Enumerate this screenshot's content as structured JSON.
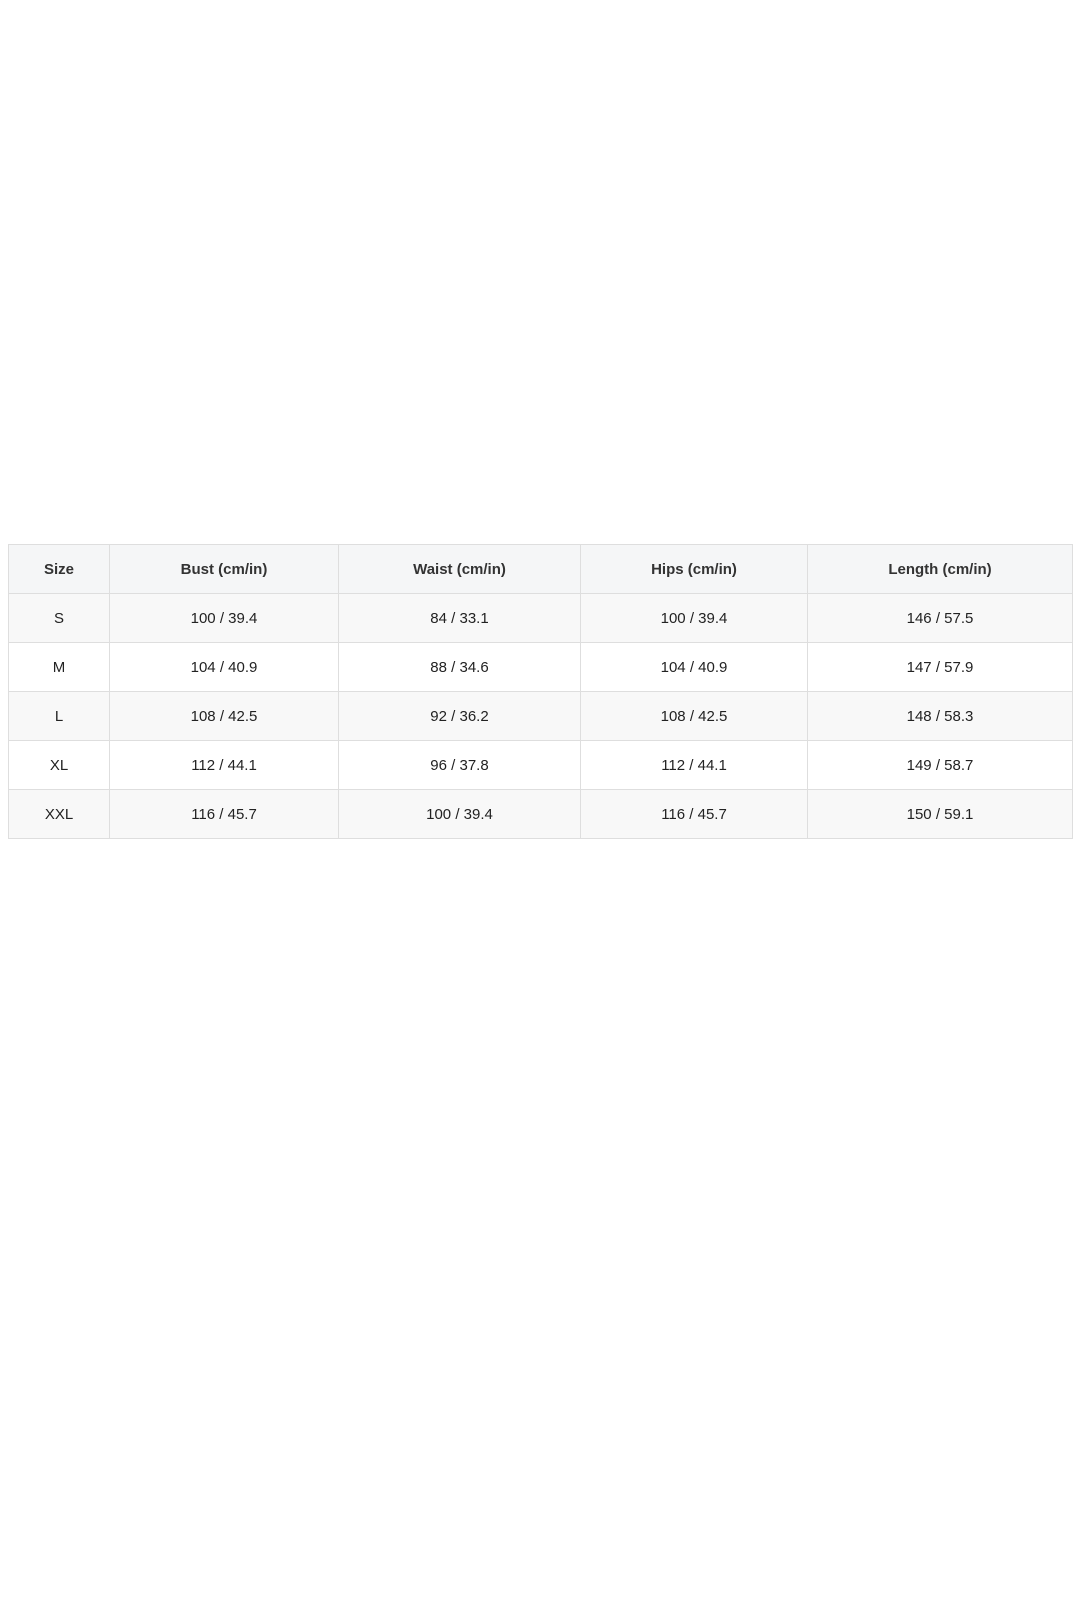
{
  "size_chart": {
    "headers": [
      "Size",
      "Bust (cm/in)",
      "Waist (cm/in)",
      "Hips (cm/in)",
      "Length (cm/in)"
    ],
    "rows": [
      [
        "S",
        "100 / 39.4",
        "84 / 33.1",
        "100 / 39.4",
        "146 / 57.5"
      ],
      [
        "M",
        "104 / 40.9",
        "88 / 34.6",
        "104 / 40.9",
        "147 / 57.9"
      ],
      [
        "L",
        "108 / 42.5",
        "92 / 36.2",
        "108 / 42.5",
        "148 / 58.3"
      ],
      [
        "XL",
        "112 / 44.1",
        "96 / 37.8",
        "112 / 44.1",
        "149 / 58.7"
      ],
      [
        "XXL",
        "116 / 45.7",
        "100 / 39.4",
        "116 / 45.7",
        "150 / 59.1"
      ]
    ]
  },
  "colors": {
    "header_background": "#f5f6f7",
    "border": "#dedede",
    "text": "#222222"
  }
}
